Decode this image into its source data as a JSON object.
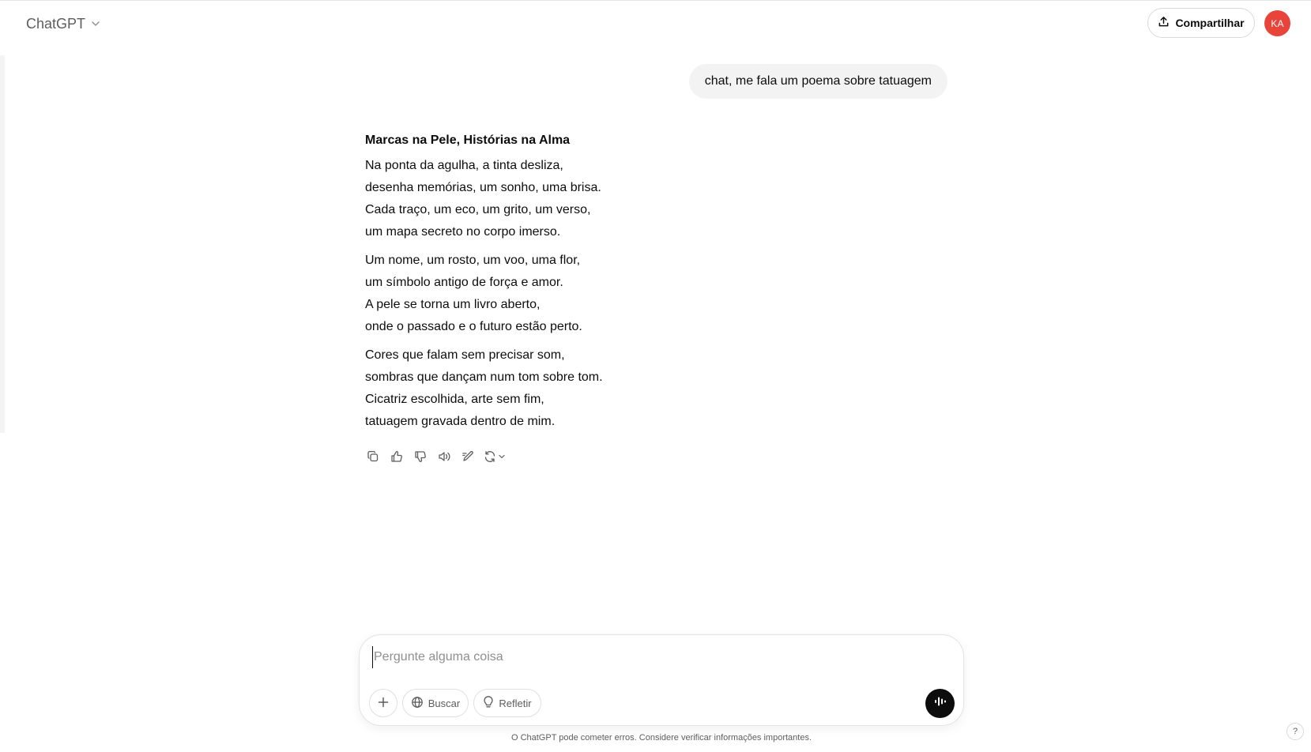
{
  "header": {
    "title": "ChatGPT",
    "share_label": "Compartilhar",
    "avatar_initials": "KA",
    "avatar_color": "#e8443a"
  },
  "conversation": {
    "user_message": "chat, me fala um poema sobre tatuagem",
    "assistant": {
      "title": "Marcas na Pele, Histórias na Alma",
      "stanzas": [
        [
          "Na ponta da agulha, a tinta desliza,",
          "desenha memórias, um sonho, uma brisa.",
          "Cada traço, um eco, um grito, um verso,",
          "um mapa secreto no corpo imerso."
        ],
        [
          "Um nome, um rosto, um voo, uma flor,",
          "um símbolo antigo de força e amor.",
          "A pele se torna um livro aberto,",
          "onde o passado e o futuro estão perto."
        ],
        [
          "Cores que falam sem precisar som,",
          "sombras que dançam num tom sobre tom.",
          "Cicatriz escolhida, arte sem fim,",
          "tatuagem gravada dentro de mim."
        ]
      ]
    },
    "actions": [
      "copy-icon",
      "thumbs-up-icon",
      "thumbs-down-icon",
      "read-aloud-icon",
      "edit-canvas-icon",
      "regenerate-icon"
    ]
  },
  "composer": {
    "placeholder": "Pergunte alguma coisa",
    "search_label": "Buscar",
    "think_label": "Refletir"
  },
  "footer": {
    "disclaimer": "O ChatGPT pode cometer erros. Considere verificar informações importantes.",
    "help_label": "?"
  }
}
